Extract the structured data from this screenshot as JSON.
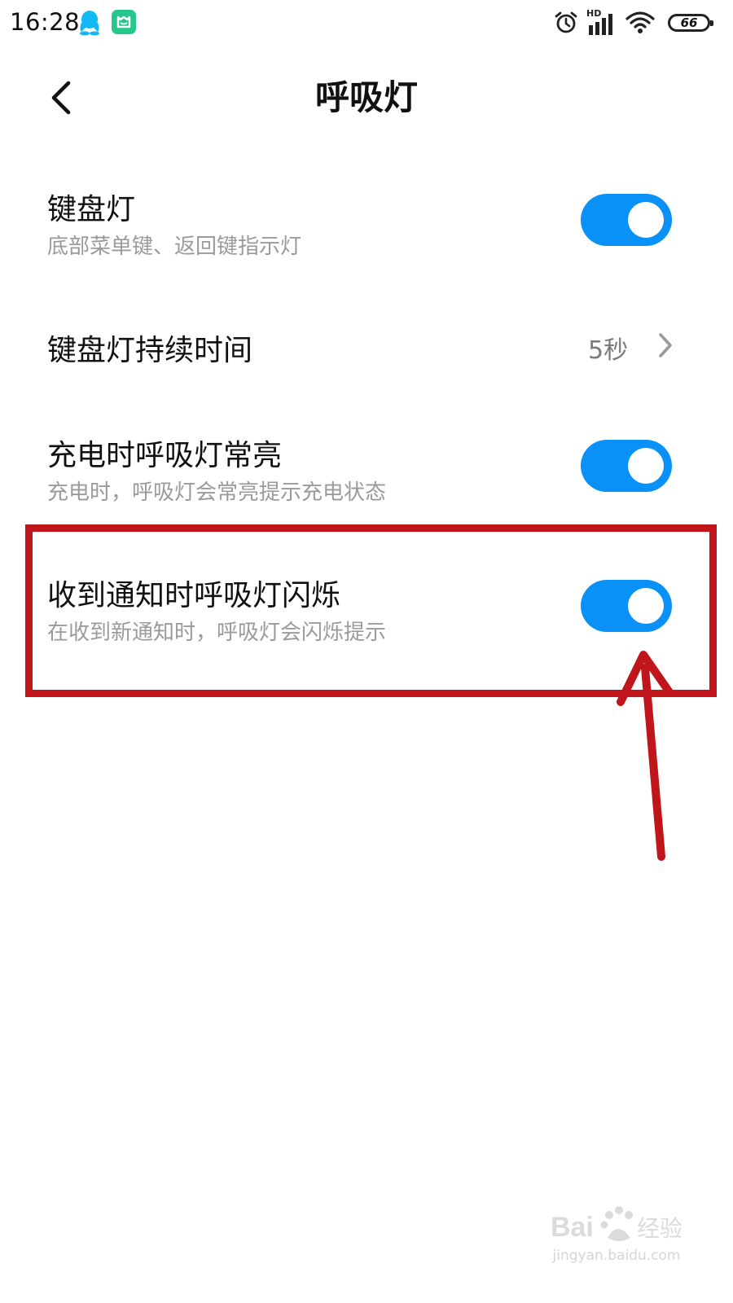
{
  "status_bar": {
    "time": "16:28",
    "network_label": "HD",
    "battery_level": "66",
    "icons": [
      "qq-icon",
      "mi-app-icon",
      "alarm-icon",
      "signal-icon",
      "wifi-icon",
      "battery-icon"
    ]
  },
  "header": {
    "title": "呼吸灯",
    "back_icon": "chevron-left-icon"
  },
  "settings": [
    {
      "title": "键盘灯",
      "subtitle": "底部菜单键、返回键指示灯",
      "control": "toggle",
      "enabled": true
    },
    {
      "title": "键盘灯持续时间",
      "value": "5秒",
      "control": "chevron-right-icon"
    },
    {
      "title": "充电时呼吸灯常亮",
      "subtitle": "充电时，呼吸灯会常亮提示充电状态",
      "control": "toggle",
      "enabled": true
    },
    {
      "title": "收到通知时呼吸灯闪烁",
      "subtitle": "在收到新通知时，呼吸灯会闪烁提示",
      "control": "toggle",
      "enabled": true
    }
  ],
  "annotation": {
    "color": "#c0151a",
    "target": "settings.3"
  },
  "watermark": {
    "brand": "Bai度经验",
    "url": "jingyan.baidu.com"
  },
  "colors": {
    "toggle_on": "#0a91f7",
    "subtitle": "#9a9a9a",
    "annotation": "#c0151a"
  }
}
